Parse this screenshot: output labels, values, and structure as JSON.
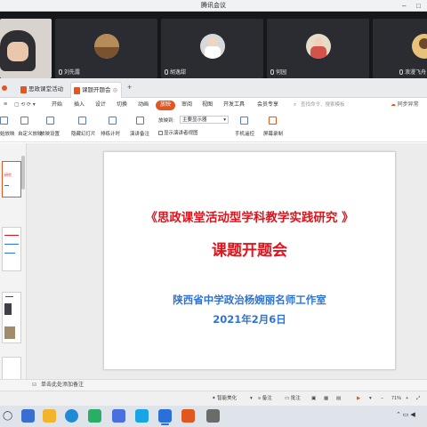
{
  "meeting": {
    "app_title": "腾讯会议",
    "participants": [
      {
        "name": "",
        "avatar_color": "#c9a07a"
      },
      {
        "name": "刘先露",
        "avatar_color": "#b78b5a"
      },
      {
        "name": "胡逸甜",
        "avatar_color": "#d9d9d9"
      },
      {
        "name": "何园",
        "avatar_color": "#d3524a"
      },
      {
        "name": "浪漫飞舟",
        "avatar_color": "#e8c17a"
      }
    ]
  },
  "wps": {
    "tabs": [
      {
        "label": "思政课堂活动型...",
        "active": false
      },
      {
        "label": "课题开题会",
        "active": true
      }
    ],
    "new_tab_label": "+",
    "menu": [
      "开始",
      "插入",
      "设计",
      "切换",
      "动画",
      "放映",
      "审阅",
      "视图",
      "开发工具",
      "会员专享"
    ],
    "active_menu": "放映",
    "search_placeholder": "查找命令、搜索模板",
    "right_menu": [
      "同步异常"
    ],
    "ribbon": {
      "left_clipped": [
        "始放映",
        "自定义放映"
      ],
      "buttons": [
        "放映设置",
        "隐藏幻灯片",
        "排练计时",
        "演讲备注"
      ],
      "monitor_label": "放映到:",
      "monitor_value": "主要显示器",
      "presenter_view": "显示演讲者视图",
      "tools": [
        "手机遥控",
        "屏幕录制"
      ]
    },
    "slide": {
      "title": "《思政课堂活动型学科教学实践研究 》",
      "subtitle": "课题开题会",
      "org": "陕西省中学政治杨婉丽名师工作室",
      "date": "2021年2月6日"
    },
    "thumbnails": [
      "1",
      "2",
      "3",
      "4"
    ],
    "notes_placeholder": "单击此处添加备注",
    "status": {
      "smart_beautify": "智能美化",
      "notes": "备注",
      "comments": "批注",
      "zoom": "71%"
    }
  },
  "taskbar": {
    "apps": [
      "search",
      "file-explorer",
      "edge",
      "wechat",
      "wps-writer",
      "wps-spreadsheet",
      "tencent-meeting",
      "wps-presentation",
      "camera"
    ]
  },
  "colors": {
    "accent": "#e2561f",
    "title_red": "#e0121b",
    "subtitle_blue": "#2d74d6"
  }
}
